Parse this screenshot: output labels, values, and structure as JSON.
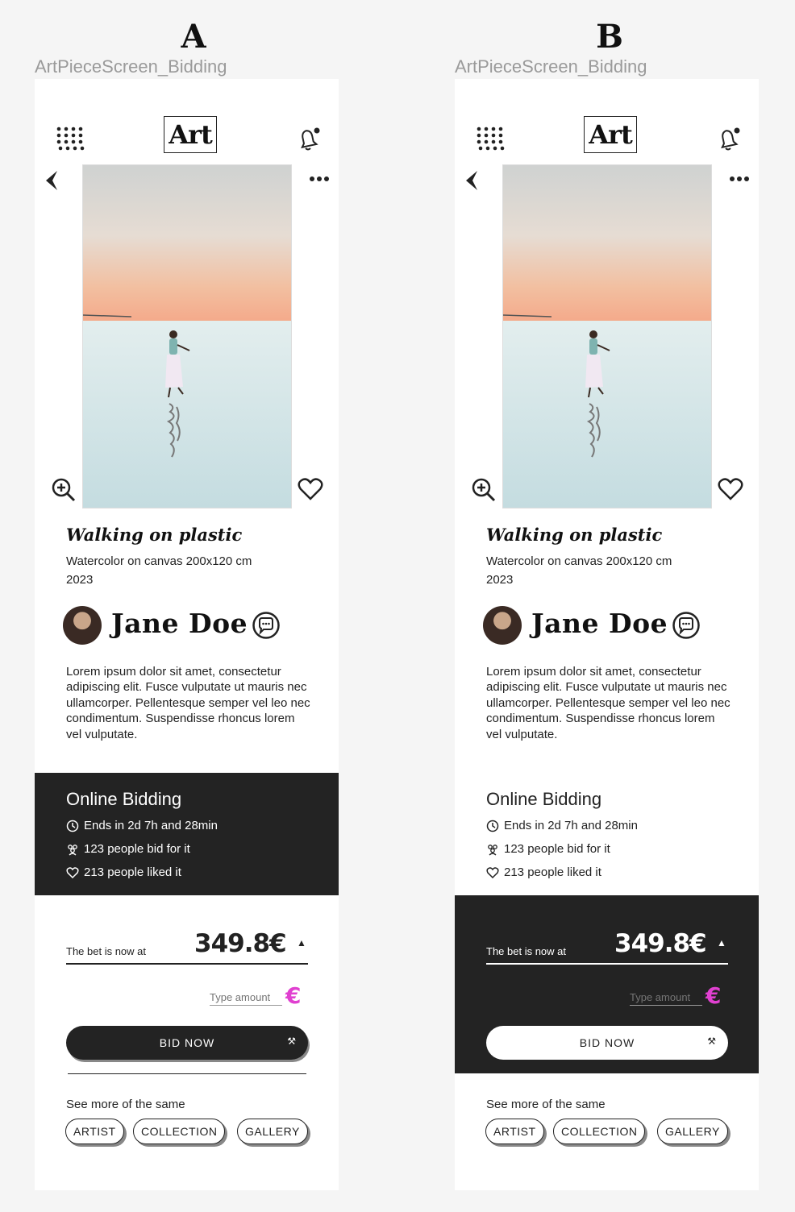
{
  "variants": [
    {
      "letter": "A",
      "frame_name": "ArtPieceScreen_Bidding",
      "logo": "Art",
      "artwork": {
        "title": "Walking on plastic",
        "medium": "Watercolor on canvas 200x120 cm",
        "year": "2023"
      },
      "artist": {
        "name": "Jane Doe"
      },
      "description": "Lorem ipsum dolor sit amet, consectetur adipiscing elit. Fusce vulputate ut mauris nec ullamcorper. Pellentesque semper vel leo nec condimentum. Suspendisse rhoncus lorem vel vulputate.",
      "bidding": {
        "heading": "Online Bidding",
        "ends": "Ends in 2d 7h and 28min",
        "bidders": "123 people bid for it",
        "likes": "213 people liked it",
        "dark_section": "bidding-info"
      },
      "bet": {
        "label": "The bet is now at",
        "value": "349.8€",
        "trend": "▲",
        "amount_placeholder": "Type amount",
        "currency": "€",
        "bid_button": "BID NOW"
      },
      "see_more": {
        "label": "See more of the same",
        "buttons": [
          "ARTIST",
          "COLLECTION",
          "GALLERY"
        ]
      }
    },
    {
      "letter": "B",
      "frame_name": "ArtPieceScreen_Bidding",
      "logo": "Art",
      "artwork": {
        "title": "Walking on plastic",
        "medium": "Watercolor on canvas 200x120 cm",
        "year": "2023"
      },
      "artist": {
        "name": "Jane Doe"
      },
      "description": "Lorem ipsum dolor sit amet, consectetur adipiscing elit. Fusce vulputate ut mauris nec ullamcorper. Pellentesque semper vel leo nec condimentum. Suspendisse rhoncus lorem vel vulputate.",
      "bidding": {
        "heading": "Online Bidding",
        "ends": "Ends in 2d 7h and 28min",
        "bidders": "123 people bid for it",
        "likes": "213 people liked it",
        "dark_section": "bet"
      },
      "bet": {
        "label": "The bet is now at",
        "value": "349.8€",
        "trend": "▲",
        "amount_placeholder": "Type amount",
        "currency": "€",
        "bid_button": "BID NOW"
      },
      "see_more": {
        "label": "See more of the same",
        "buttons": [
          "ARTIST",
          "COLLECTION",
          "GALLERY"
        ]
      }
    }
  ],
  "colors": {
    "dark": "#232323",
    "accent_euro": "#e040d0",
    "page_bg": "#f5f5f5"
  },
  "icons": [
    "menu-dots-icon",
    "bell-icon",
    "back-chevron-icon",
    "more-icon",
    "zoom-in-icon",
    "heart-icon",
    "chat-icon",
    "clock-icon",
    "people-icon",
    "heart-outline-icon",
    "hammer-icon"
  ]
}
